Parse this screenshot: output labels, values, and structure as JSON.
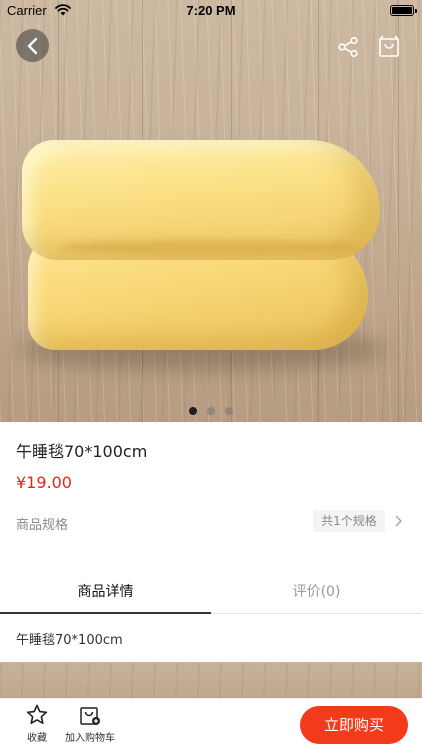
{
  "status_bar": {
    "carrier": "Carrier",
    "time": "7:20 PM"
  },
  "nav": {
    "back_icon": "chevron-left-icon",
    "share_icon": "share-icon",
    "bag_icon": "shopping-bag-icon"
  },
  "carousel": {
    "count": 3,
    "active_index": 0
  },
  "product": {
    "title": "午睡毯70*100cm",
    "price": "¥19.00",
    "spec_label": "商品规格",
    "spec_count": "共1个规格"
  },
  "tabs": [
    {
      "label": "商品详情",
      "active": true
    },
    {
      "label": "评价(0)",
      "active": false
    }
  ],
  "details": {
    "text": "午睡毯70*100cm"
  },
  "bottom_bar": {
    "favorite_label": "收藏",
    "cart_label": "加入购物车",
    "buy_label": "立即购买"
  },
  "colors": {
    "accent": "#f33a1a",
    "price": "#e8251c"
  }
}
